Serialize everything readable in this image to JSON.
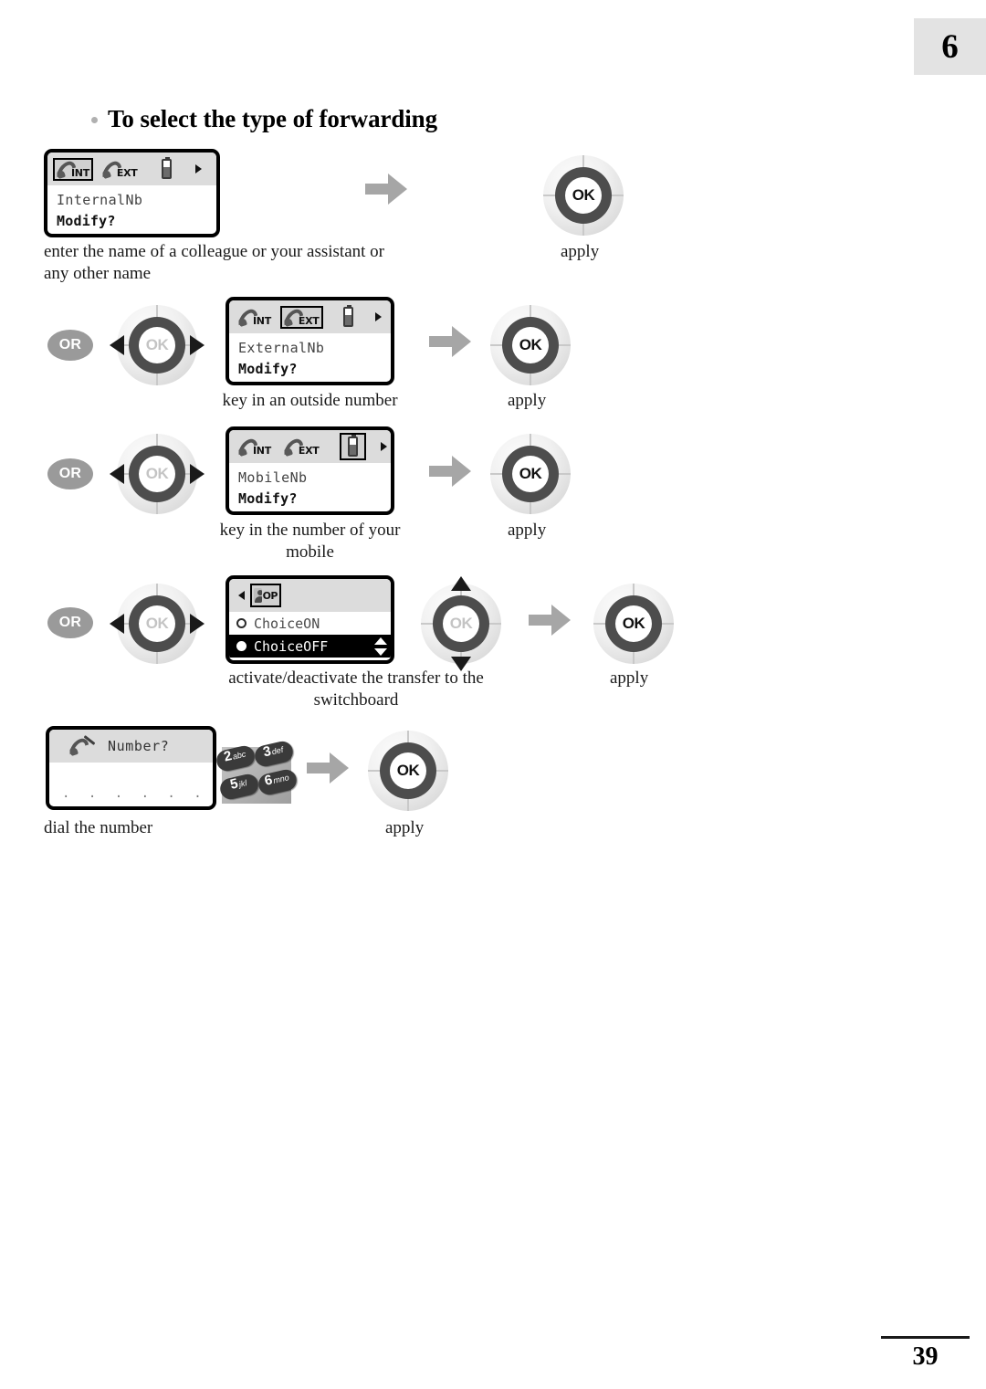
{
  "page": {
    "chapter_number": "6",
    "page_number": "39",
    "heading": "To select the type of forwarding"
  },
  "steps": [
    {
      "id": "internal",
      "screen": {
        "statusbar": [
          {
            "icon": "handset-int-icon",
            "label": "INT",
            "selected": true
          },
          {
            "icon": "handset-ext-icon",
            "label": "EXT",
            "selected": false
          },
          {
            "icon": "battery-icon",
            "label": "",
            "selected": false
          },
          {
            "icon": "chevron-right-icon",
            "label": "",
            "selected": false
          }
        ],
        "line1": "InternalNb",
        "line2": "Modify?"
      },
      "caption": "enter the name of a colleague or your assistant or any other name",
      "apply_label": "apply"
    },
    {
      "id": "external",
      "or_label": "OR",
      "screen": {
        "statusbar": [
          {
            "icon": "handset-int-icon",
            "label": "INT",
            "selected": false
          },
          {
            "icon": "handset-ext-icon",
            "label": "EXT",
            "selected": true
          },
          {
            "icon": "battery-icon",
            "label": "",
            "selected": false
          },
          {
            "icon": "chevron-right-icon",
            "label": "",
            "selected": false
          }
        ],
        "line1": "ExternalNb",
        "line2": "Modify?"
      },
      "caption": "key in an outside number",
      "apply_label": "apply"
    },
    {
      "id": "mobile",
      "or_label": "OR",
      "screen": {
        "statusbar": [
          {
            "icon": "handset-int-icon",
            "label": "INT",
            "selected": false
          },
          {
            "icon": "handset-ext-icon",
            "label": "EXT",
            "selected": false
          },
          {
            "icon": "battery-icon",
            "label": "",
            "selected": true
          },
          {
            "icon": "chevron-right-icon",
            "label": "",
            "selected": false
          }
        ],
        "line1": "MobileNb",
        "line2": "Modify?"
      },
      "caption": "key in the number of your mobile",
      "apply_label": "apply"
    },
    {
      "id": "switchboard",
      "or_label": "OR",
      "screen": {
        "statusbar": [
          {
            "icon": "chevron-left-icon",
            "label": "",
            "selected": false
          },
          {
            "icon": "operator-icon",
            "label": "OP",
            "selected": true
          }
        ],
        "options": [
          {
            "label": "ChoiceON",
            "selected": false
          },
          {
            "label": "ChoiceOFF",
            "selected": true
          }
        ]
      },
      "caption": "activate/deactivate the transfer to the switchboard",
      "apply_label": "apply"
    },
    {
      "id": "dial",
      "screen": {
        "title_icon": "handset-pencil-icon",
        "title": "Number?",
        "entry_dots": ". . . . . . ."
      },
      "keypad": [
        {
          "digit": "2",
          "letters": "abc"
        },
        {
          "digit": "3",
          "letters": "def"
        },
        {
          "digit": "5",
          "letters": "jkl"
        },
        {
          "digit": "6",
          "letters": "mno"
        }
      ],
      "caption": "dial the number",
      "apply_label": "apply"
    }
  ],
  "ok_label": "OK"
}
